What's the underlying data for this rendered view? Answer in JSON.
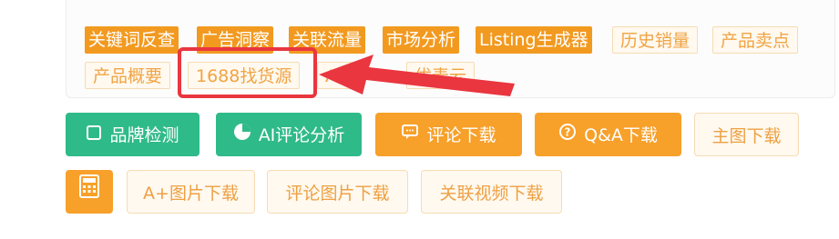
{
  "tags_row1": [
    {
      "label": "关键词反查",
      "style": "solid"
    },
    {
      "label": "广告洞察",
      "style": "solid"
    },
    {
      "label": "关联流量",
      "style": "solid"
    },
    {
      "label": "市场分析",
      "style": "solid"
    },
    {
      "label": "Listing生成器",
      "style": "solid"
    },
    {
      "label": "历史销量",
      "style": "ghost"
    },
    {
      "label": "产品卖点",
      "style": "ghost"
    }
  ],
  "tags_row2": [
    {
      "label": "产品概要",
      "style": "ghost"
    },
    {
      "label": "1688找货源",
      "style": "ghost"
    },
    {
      "label": "Ali",
      "style": "ghost"
    },
    {
      "label": "优麦云",
      "style": "ghost"
    }
  ],
  "actions_row1": [
    {
      "label": "品牌检测",
      "icon": "checkbox-icon",
      "style": "green"
    },
    {
      "label": "AI评论分析",
      "icon": "pie-chart-icon",
      "style": "green"
    },
    {
      "label": "评论下载",
      "icon": "chat-icon",
      "style": "orange"
    },
    {
      "label": "Q&A下载",
      "icon": "question-icon",
      "style": "orange"
    },
    {
      "label": "主图下载",
      "icon": "",
      "style": "ghost"
    }
  ],
  "actions_row2": [
    {
      "label": "",
      "icon": "calculator-icon",
      "style": "orange"
    },
    {
      "label": "A+图片下载",
      "icon": "",
      "style": "ghost"
    },
    {
      "label": "评论图片下载",
      "icon": "",
      "style": "ghost"
    },
    {
      "label": "关联视频下载",
      "icon": "",
      "style": "ghost"
    }
  ],
  "colors": {
    "orange": "#f29a20",
    "green": "#2fba8a",
    "highlight_red": "#e9363f"
  }
}
